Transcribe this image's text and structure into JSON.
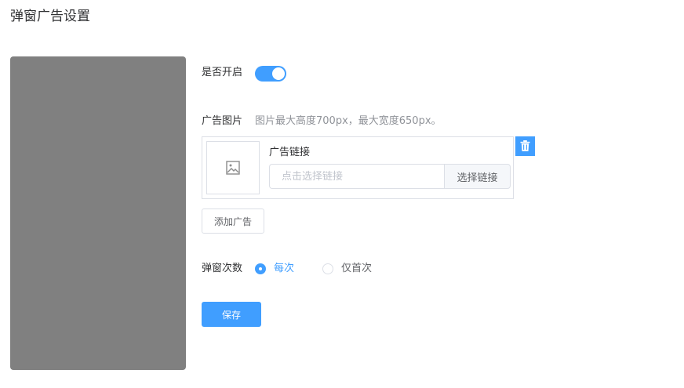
{
  "page": {
    "title": "弹窗广告设置"
  },
  "preview": {
    "bg_color": "#808080"
  },
  "form": {
    "enable": {
      "label": "是否开启",
      "value": true
    },
    "ad_image": {
      "label": "广告图片",
      "hint": "图片最大高度700px，最大宽度650px。"
    },
    "ad_item": {
      "link_label": "广告链接",
      "link_value": "",
      "link_placeholder": "点击选择链接",
      "select_link_button": "选择链接",
      "image_icon": "image-icon",
      "delete_icon": "trash-icon"
    },
    "add_ad_button": "添加广告",
    "frequency": {
      "label": "弹窗次数",
      "options": [
        {
          "label": "每次",
          "selected": true
        },
        {
          "label": "仅首次",
          "selected": false
        }
      ]
    },
    "save_button": "保存"
  },
  "colors": {
    "accent": "#409eff",
    "border": "#dcdfe6",
    "text": "#303133",
    "muted": "#909399"
  }
}
